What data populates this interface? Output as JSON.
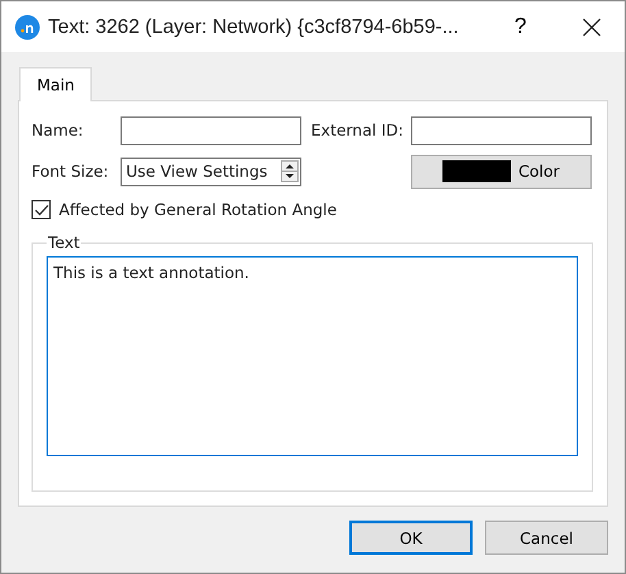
{
  "window": {
    "title": "Text: 3262 (Layer: Network) {c3cf8794-6b59-...",
    "help": "?"
  },
  "tabs": [
    {
      "label": "Main",
      "selected": true
    }
  ],
  "fields": [
    {
      "label": "Name:"
    },
    {
      "label": "External ID:"
    }
  ],
  "font_size": {
    "label": "Font Size:",
    "value": "Use View Settings"
  },
  "color_button": {
    "label": "Color",
    "color": "#000000"
  },
  "checkbox": {
    "label": "Affected by General Rotation Angle",
    "checked": true
  },
  "text_group": {
    "title": "Text",
    "value": "This is a text annotation."
  },
  "buttons": [
    {
      "label": "OK",
      "default": true
    },
    {
      "label": "Cancel",
      "default": false
    }
  ]
}
